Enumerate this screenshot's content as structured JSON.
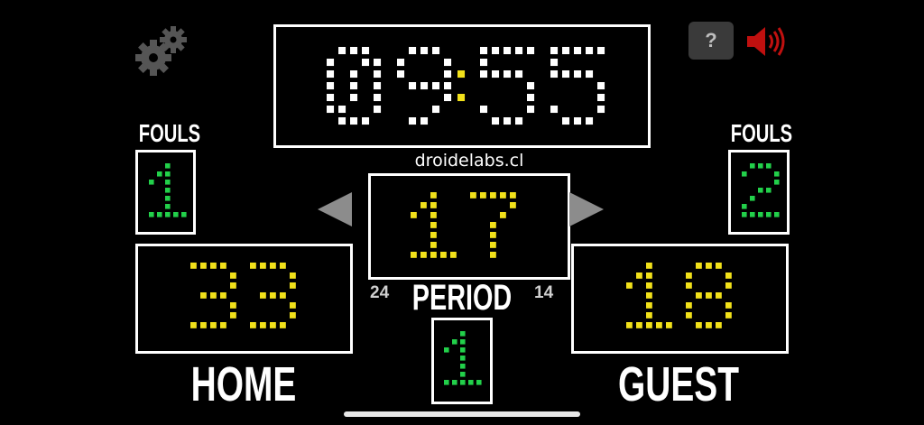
{
  "clock": {
    "minutes": "09",
    "seconds": "55"
  },
  "watermark": "droidelabs.cl",
  "shot_clock": {
    "value": "17",
    "left_number": "24",
    "right_number": "14"
  },
  "home": {
    "label": "HOME",
    "score": "33",
    "fouls_label": "FOULS",
    "fouls": "1"
  },
  "guest": {
    "label": "GUEST",
    "score": "18",
    "fouls_label": "FOULS",
    "fouls": "2"
  },
  "period": {
    "label": "PERIOD",
    "value": "1"
  },
  "help_button": {
    "label": "?"
  },
  "icons": {
    "settings": "gears-icon",
    "sound": "speaker-icon",
    "prev": "triangle-left-icon",
    "next": "triangle-right-icon"
  },
  "colors": {
    "clock": "#ffffff",
    "score": "#f2e11a",
    "fouls": "#22d04a",
    "period": "#22d04a",
    "shot_clock": "#f2e11a",
    "arrow": "#8c8c8c",
    "speaker": "#c0100f"
  }
}
